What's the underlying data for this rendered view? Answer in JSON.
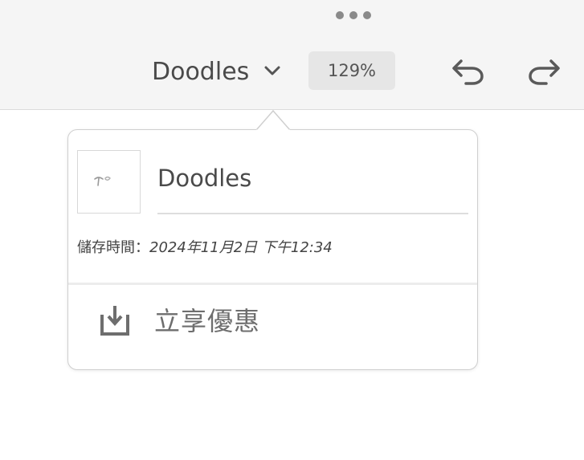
{
  "toolbar": {
    "more_icon": "more-horizontal-icon",
    "doc_title": "Doodles",
    "title_menu_icon": "chevron-down-icon",
    "zoom": "129%",
    "undo_icon": "undo-icon",
    "redo_icon": "redo-icon"
  },
  "popover": {
    "thumbnail_icon": "document-thumbnail",
    "name_value": "Doodles",
    "saved_label": "儲存時間：",
    "saved_value": "2024年11月2日 下午12:34",
    "promo_icon": "download-tray-icon",
    "promo_label": "立享優惠"
  },
  "colors": {
    "toolbar_bg": "#f5f5f5",
    "text": "#4a4a4a",
    "icon": "#666666",
    "zoom_bg": "#e6e6e6"
  }
}
